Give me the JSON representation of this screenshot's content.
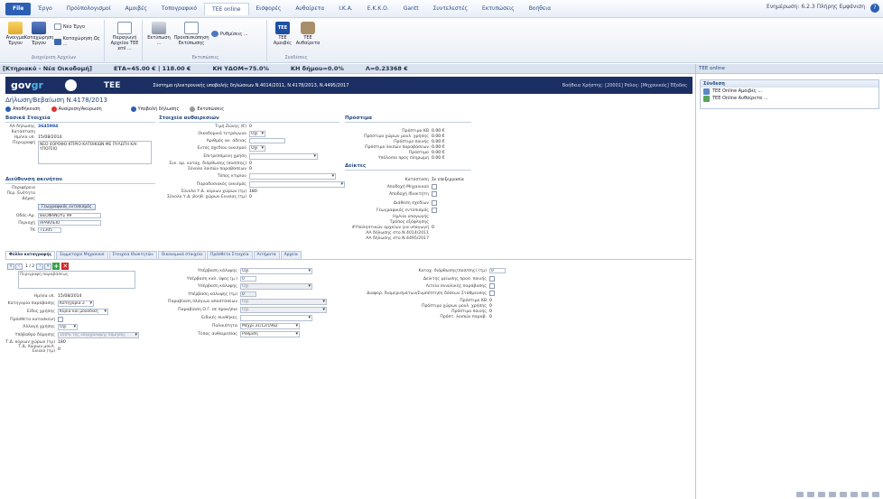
{
  "ribbon_tabs": {
    "file": "File",
    "tabs": [
      "Έργο",
      "Προϋπολογισμοί",
      "Αμοιβές",
      "Τοπογραφικό",
      "TEE online",
      "Εισφορές",
      "Αυθαίρετα",
      "Ι.Κ.Α.",
      "Ε.Κ.Κ.Ο.",
      "Gantt",
      "Συντελεστές",
      "Εκτυπώσεις",
      "Βοήθεια"
    ],
    "active": "TEE online",
    "user_info": "Ενημέρωση: 6.2.3 Πλήρης Εμφάνιση"
  },
  "ribbon": {
    "open_label": "Άνοιγμα Έργου",
    "save_label": "Καταχώρηση Έργου",
    "new_project": "Νέο Έργο",
    "save_as": "Καταχώρηση Ως ...",
    "group_files": "Διαχείριση Αρχείων",
    "produce_xml": "Παραγωγή Αρχείου ΤΕΕ xml ...",
    "print_label": "Εκτύπωση ...",
    "preview_label": "Προεπισκόπηση Εκτύπωσης",
    "settings_label": "Ρυθμίσεις ...",
    "group_print": "Εκτυπώσεις",
    "tee_fees": "TEE Αμοιβές",
    "tee_illegal": "TEE Αυθαίρετα",
    "group_links": "Συνδέσεις"
  },
  "status_bar": {
    "item1": "[Κτηριακό - Νέα Οικοδομή]",
    "item2": "ΕΤΑ=45.00 € | 118.00 €",
    "item3": "ΚΗ ΥΔΟΜ=75.0%",
    "item4": "ΚΗ δήμου=0.0%",
    "item5": "Λ=0.23368 €"
  },
  "banner": {
    "title": "Σύστημα ηλεκτρονικής υποβολής δηλώσεων Ν.4014/2011, Ν.4178/2013, Ν.4495/2017",
    "right": "Βοήθεια   Χρήστης: [20001] Ρόλος: [Μηχανικός]   Έξοδος"
  },
  "doc_title": "Δήλωση/Βεβαίωση Ν.4178/2013",
  "toolbar2": {
    "save": "Αποθήκευση",
    "remove": "Αναίρεση/Ακύρωση",
    "submit": "Υποβολή δήλωσης",
    "print": "Εκτυπώσεις"
  },
  "basic": {
    "title": "Βασικά Στοιχεία",
    "labels": [
      "ΑΑ δήλωσης",
      "Κατάσταση",
      "Ημ/νία υπ.",
      "Περιγραφή"
    ],
    "aa": "3645984",
    "status": "",
    "date": "15/08/2014",
    "description": "ΝΕΟ 4ΟΡΟΦΟ ΚΤΙΡΙΟ ΚΑΤΟΙΚΙΩΝ ΜΕ ΠΥΛΩΤΗ ΚΑΙ ΥΠΟΓΕΙΟ"
  },
  "address": {
    "title": "Διεύθυνση ακινήτου",
    "labels": [
      "Περιφέρεια",
      "Περ. Ενότητα",
      "Δήμος",
      "Οδός-Αρ.",
      "Περιοχή",
      "ΤΚ"
    ],
    "geo_button": "Γεωγραφικός εντοπισμός",
    "street": "ΘΕΟΦΑΝΟΥΣ 99",
    "area": "ΗΡΑΚΛΕΙΟ",
    "zip": "71305"
  },
  "building": {
    "title": "Στοιχεία αυθαιρεσιών",
    "rows": [
      {
        "label": "Τιμή Ζώνης (€)",
        "value": "0"
      },
      {
        "label": "Οικοδομικό τετράγωνο",
        "value": "Όχι"
      },
      {
        "label": "Αριθμός αν. άδειας",
        "value": ""
      },
      {
        "label": "Εντός σχεδίου οικισμού",
        "value": "Όχι"
      },
      {
        "label": "Επιτρεπόμενη χρήση",
        "value": ""
      },
      {
        "label": "Συν. αρ. καταχ. διόρθωσης (ποσ/σης)",
        "value": "0"
      },
      {
        "label": "Σύνολο λοιπών παραβάσεων",
        "value": "0"
      },
      {
        "label": "Τύπος κτιρίου",
        "value": ""
      },
      {
        "label": "Παραδοσιακός οικισμός",
        "value": ""
      },
      {
        "label": "Σύνολο Υ.Δ. κύριων χώρων (τμ)",
        "value": "180"
      },
      {
        "label": "Σύνολο Υ.Δ. βοηθ. χώρων Ενιαίας (τμ)",
        "value": "0"
      }
    ]
  },
  "fees": {
    "title": "Πρόστιμα",
    "rows": [
      {
        "label": "Πρόστιμο ΚΒ",
        "value": "0.00 €"
      },
      {
        "label": "Πρόστιμο χώρων μουλ. χρήσης",
        "value": "0.00 €"
      },
      {
        "label": "Πρόστιμο ποινής",
        "value": "0.00 €"
      },
      {
        "label": "Πρόστιμο λοιπών παραβάσεων",
        "value": "0.00 €"
      },
      {
        "label": "Πρόστιμο",
        "value": "0.00 €"
      },
      {
        "label": "Υπόλοιπο προς πληρωμή",
        "value": "0.00 €"
      }
    ]
  },
  "indicators": {
    "title": "Δείκτες",
    "rows": [
      {
        "label": "Κατάσταση",
        "value": "Σε επεξεργασία"
      },
      {
        "label": "Αποδοχή Μηχανικού",
        "value": ""
      },
      {
        "label": "Αποδοχή Ιδιοκτήτη",
        "value": ""
      },
      {
        "label": "Διάθεση σχεδίων",
        "value": ""
      },
      {
        "label": "Γεωγραφικός εντοπισμός",
        "value": ""
      },
      {
        "label": "Ημ/νία υπαγωγής",
        "value": ""
      },
      {
        "label": "Τρόπος εξόφλησης",
        "value": ""
      },
      {
        "label": "#Υποληπτικών αρχείων για υπαγωγή",
        "value": "0"
      },
      {
        "label": "ΑΑ δήλωσης στο Ν.4014/2011",
        "value": ""
      },
      {
        "label": "ΑΑ δήλωσης στο Ν.4495/2017",
        "value": ""
      }
    ]
  },
  "tabs": [
    "Φύλλο καταγραφής",
    "Συμμετοχοί Μηχανικοί",
    "Στοιχεία Ιδιοκτητών",
    "Οικονομικά στοιχεία",
    "Πρόσθετα Στοιχεία",
    "Αιτήματα",
    "Αρχεία"
  ],
  "sheet": {
    "pager": "1 / 2",
    "description_label": "Περιγραφή παραβάσεως",
    "col1": [
      {
        "label": "Ημ/νία υπ.",
        "value": "15/08/2014"
      },
      {
        "label": "Κατηγορία παράβασης",
        "value": "Κατηγορία 2"
      },
      {
        "label": "Είδος χρήσης",
        "value": "Κύρια και μοναδική κατοικία"
      },
      {
        "label": "Πρόσθετα κατασκευή",
        "value": ""
      },
      {
        "label": "Αλλαγή χρήσης",
        "value": "Όχι"
      },
      {
        "label": "Υπόβαθρο δόμησης",
        "value": "100% της υπερχάλυψης δόμησης"
      },
      {
        "label": "Τ.Δ. κύριων χώρων (τμ)",
        "value": "180"
      },
      {
        "label": "Τ.Δ. Χώρων μουλ. Ενιαίο (τμ)",
        "value": "0"
      }
    ],
    "col2": [
      {
        "label": "Υπέρβαση κάλυψης",
        "value": "Όχι"
      },
      {
        "label": "Υπέρβαση καλ. ύψος (μ.)",
        "value": "0"
      },
      {
        "label": "Υπέρβαση κάλυψης",
        "value": "Όχι"
      },
      {
        "label": "Υπέρβαση κάλυψης (τμ)",
        "value": "0"
      },
      {
        "label": "Παραβίαση πλάγιων αποστάσεων",
        "value": "Όχι"
      },
      {
        "label": "Παραβίαση Ο.Γ. σε προκήπιο",
        "value": "Όχι"
      },
      {
        "label": "Ειδικές συνθήκες",
        "value": ""
      },
      {
        "label": "Παλαιότητα",
        "value": "Μέχρι 31/12/1982"
      },
      {
        "label": "Τύπος αυθαιρεσίας",
        "value": "Ρύθμιση"
      }
    ],
    "col3": [
      {
        "label": "Καταχ. διόρθωσης(ποσ/σης) (τμ)",
        "value": "0"
      },
      {
        "label": "Δείκτης μείωσης προσ. ποινής",
        "value": ""
      },
      {
        "label": "Αιτεία συνολικής παράβασης",
        "value": ""
      },
      {
        "label": "Διαφορ. διαμερισμάτων/Συμπέπτηση δόσεων Στάθμευσης",
        "value": ""
      },
      {
        "label": "Πρόστιμο ΚΒ",
        "value": "0"
      },
      {
        "label": "Πρόστιμο χώρων μουλ. χρήσης",
        "value": "0"
      },
      {
        "label": "Πρόστιμο ποινής",
        "value": "0"
      },
      {
        "label": "Πρόστ. λοιπών παραβ.",
        "value": "0"
      }
    ]
  },
  "right_pane": {
    "header": "TEE online",
    "group": "Σύνδεση",
    "item1": "TEE Online Αμοιβές ...",
    "item2": "TEE Online Αυθαίρετα ..."
  }
}
